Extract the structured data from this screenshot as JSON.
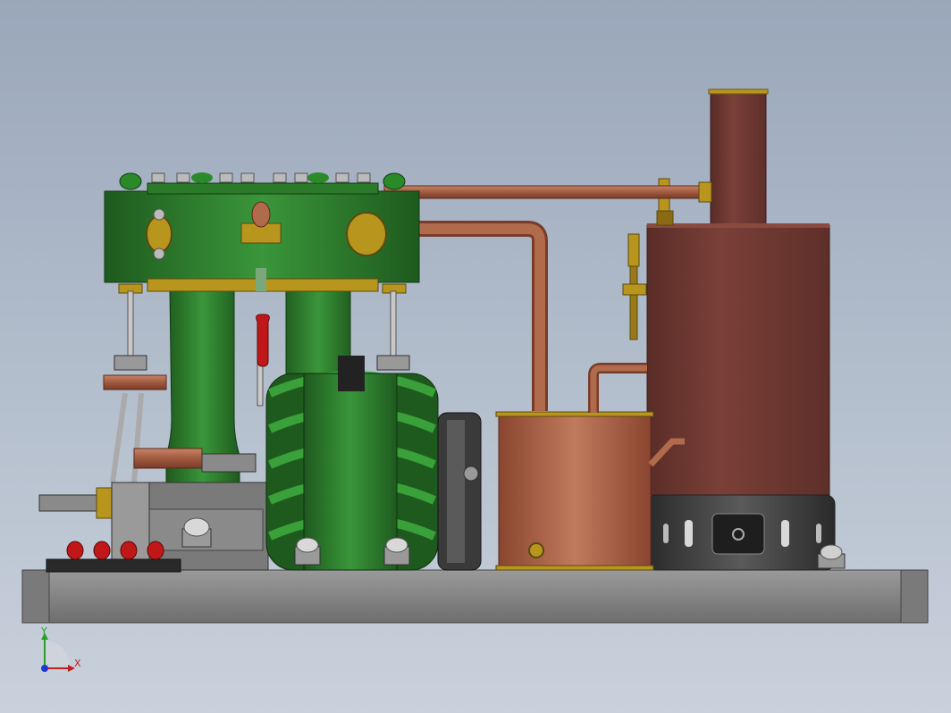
{
  "triad": {
    "x_label": "X",
    "y_label": "Y"
  },
  "colors": {
    "background_top": "#9aa7ba",
    "background_bottom": "#c9d1dc",
    "engine_green": "#2e7d2e",
    "engine_green_dark": "#1b4e1b",
    "copper": "#b0654a",
    "copper_dark": "#7d3f2a",
    "boiler": "#6e3a33",
    "base_gray": "#8a8a8a",
    "brass": "#b8961e",
    "red_knob": "#c01818"
  }
}
